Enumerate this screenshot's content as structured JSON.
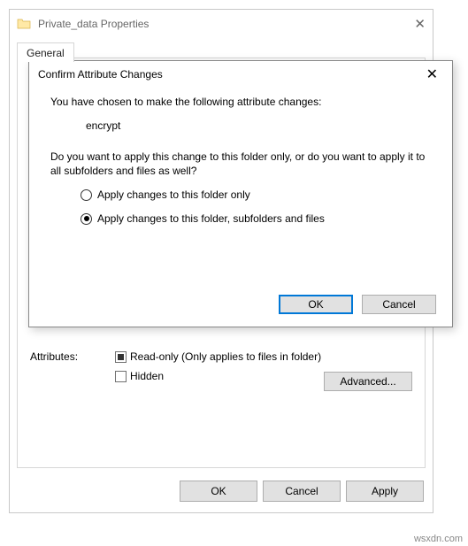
{
  "props": {
    "title": "Private_data Properties",
    "tabs": {
      "active": "General"
    },
    "attributes": {
      "label": "Attributes:",
      "readonly_label": "Read-only (Only applies to files in folder)",
      "hidden_label": "Hidden",
      "advanced_label": "Advanced..."
    },
    "buttons": {
      "ok": "OK",
      "cancel": "Cancel",
      "apply": "Apply"
    }
  },
  "modal": {
    "title": "Confirm Attribute Changes",
    "line1": "You have chosen to make the following attribute changes:",
    "change": "encrypt",
    "line2": "Do you want to apply this change to this folder only, or do you want to apply it to all subfolders and files as well?",
    "radio1": "Apply changes to this folder only",
    "radio2": "Apply changes to this folder, subfolders and files",
    "buttons": {
      "ok": "OK",
      "cancel": "Cancel"
    }
  },
  "watermark": "wsxdn.com"
}
